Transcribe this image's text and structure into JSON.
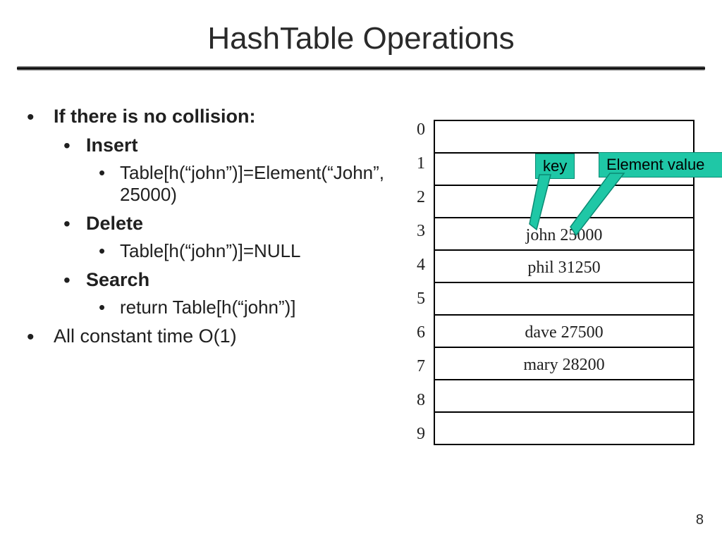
{
  "title": "HashTable Operations",
  "bullets": {
    "b1": "If there is no collision:",
    "b2": "Insert",
    "b2a": "Table[h(“john”)]=Element(“John”, 25000)",
    "b3": "Delete",
    "b3a": "Table[h(“john”)]=NULL",
    "b4": "Search",
    "b4a": "return Table[h(“john”)]",
    "b5": "All constant time O(1)"
  },
  "table": {
    "indices": [
      "0",
      "1",
      "2",
      "3",
      "4",
      "5",
      "6",
      "7",
      "8",
      "9"
    ],
    "rows": [
      "",
      "",
      "",
      "john 25000",
      "phil 31250",
      "",
      "dave 27500",
      "mary 28200",
      "",
      ""
    ]
  },
  "callouts": {
    "key": "key",
    "value": "Element value"
  },
  "page": "8"
}
